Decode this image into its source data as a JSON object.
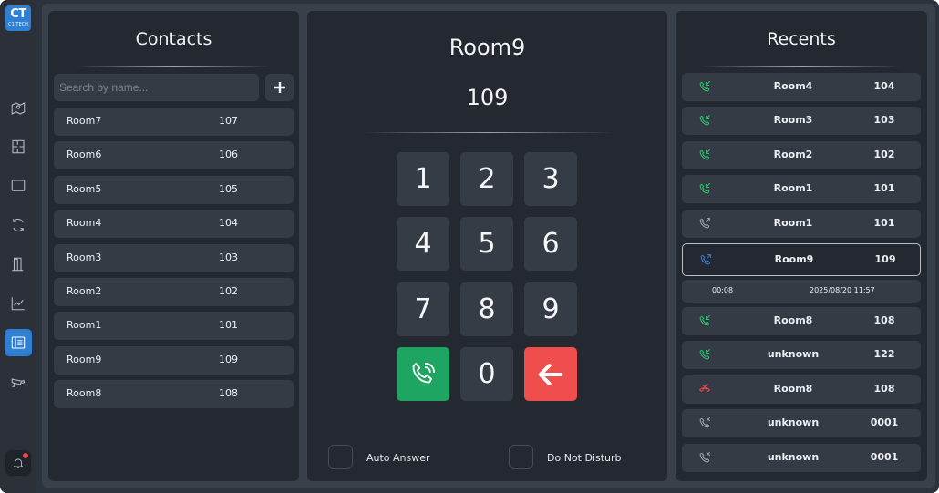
{
  "brand": {
    "logo_text": "CT",
    "logo_subtext": "C1 TECH",
    "accent_color": "#2f7fd3"
  },
  "sidebar": {
    "items": [
      {
        "icon": "map-icon"
      },
      {
        "icon": "floor-plan-icon"
      },
      {
        "icon": "screen-icon"
      },
      {
        "icon": "sync-icon"
      },
      {
        "icon": "door-icon"
      },
      {
        "icon": "chart-icon"
      },
      {
        "icon": "intercom-icon",
        "active": true
      },
      {
        "icon": "camera-icon"
      }
    ],
    "notifications": {
      "icon": "bell-icon",
      "has_unread": true
    }
  },
  "contacts": {
    "title": "Contacts",
    "search_placeholder": "Search by name...",
    "add_icon": "plus-icon",
    "items": [
      {
        "name": "Room7",
        "number": "107"
      },
      {
        "name": "Room6",
        "number": "106"
      },
      {
        "name": "Room5",
        "number": "105"
      },
      {
        "name": "Room4",
        "number": "104"
      },
      {
        "name": "Room3",
        "number": "103"
      },
      {
        "name": "Room2",
        "number": "102"
      },
      {
        "name": "Room1",
        "number": "101"
      },
      {
        "name": "Room9",
        "number": "109"
      },
      {
        "name": "Room8",
        "number": "108"
      }
    ]
  },
  "dialer": {
    "name": "Room9",
    "number": "109",
    "keys": [
      "1",
      "2",
      "3",
      "4",
      "5",
      "6",
      "7",
      "8",
      "9"
    ],
    "zero": "0",
    "call_icon": "phone-icon",
    "backspace_icon": "arrow-left-icon",
    "call_color": "#1fa562",
    "backspace_color": "#f04d4d",
    "auto_answer_label": "Auto Answer",
    "auto_answer_checked": false,
    "dnd_label": "Do Not Disturb",
    "dnd_checked": false
  },
  "recents": {
    "title": "Recents",
    "items": [
      {
        "name": "Room4",
        "number": "104",
        "kind": "incoming",
        "color": "#2bbf6e"
      },
      {
        "name": "Room3",
        "number": "103",
        "kind": "incoming",
        "color": "#2bbf6e"
      },
      {
        "name": "Room2",
        "number": "102",
        "kind": "incoming",
        "color": "#2bbf6e"
      },
      {
        "name": "Room1",
        "number": "101",
        "kind": "incoming",
        "color": "#2bbf6e"
      },
      {
        "name": "Room1",
        "number": "101",
        "kind": "outgoing",
        "color": "#9aa0a9"
      },
      {
        "name": "Room9",
        "number": "109",
        "kind": "outgoing",
        "color": "#2f7fd3",
        "selected": true
      },
      {
        "name": "Room8",
        "number": "108",
        "kind": "incoming",
        "color": "#2bbf6e"
      },
      {
        "name": "unknown",
        "number": "122",
        "kind": "incoming",
        "color": "#2bbf6e"
      },
      {
        "name": "Room8",
        "number": "108",
        "kind": "missed",
        "color": "#e8474b"
      },
      {
        "name": "unknown",
        "number": "0001",
        "kind": "rejected",
        "color": "#9aa0a9"
      },
      {
        "name": "unknown",
        "number": "0001",
        "kind": "rejected",
        "color": "#9aa0a9"
      }
    ],
    "detail": {
      "duration": "00:08",
      "timestamp": "2025/08/20 11:57"
    }
  }
}
